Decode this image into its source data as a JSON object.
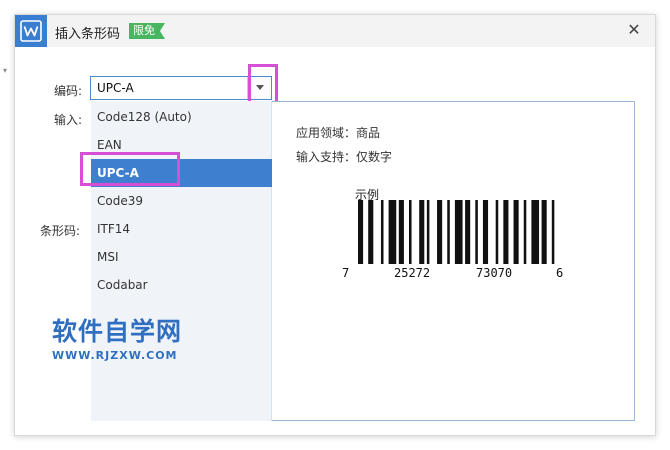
{
  "dialog": {
    "title": "插入条形码",
    "badge": "限免",
    "close_glyph": "✕"
  },
  "form": {
    "encoding_label": "编码:",
    "input_label": "输入:",
    "barcode_label": "条形码:",
    "selected_encoding": "UPC-A"
  },
  "dropdown": {
    "options": [
      "Code128 (Auto)",
      "EAN",
      "UPC-A",
      "Code39",
      "ITF14",
      "MSI",
      "Codabar"
    ],
    "selected_index": 2
  },
  "info": {
    "domain": "应用领域：商品",
    "support": "输入支持：仅数字"
  },
  "sample": {
    "label": "示例",
    "digits_left": "7",
    "digits_group1": "25272",
    "digits_group2": "73070",
    "digits_right": "6"
  },
  "watermark": {
    "main": "软件自学网",
    "sub": "WWW.RJZXW.COM"
  },
  "colors": {
    "accent": "#3f7fcf",
    "highlight": "#d64fd6",
    "badge": "#48b561",
    "watermark": "#2f6ec0"
  },
  "icons": {
    "app": "wps-w-icon",
    "close": "close-icon",
    "dropdown": "chevron-down-icon"
  }
}
